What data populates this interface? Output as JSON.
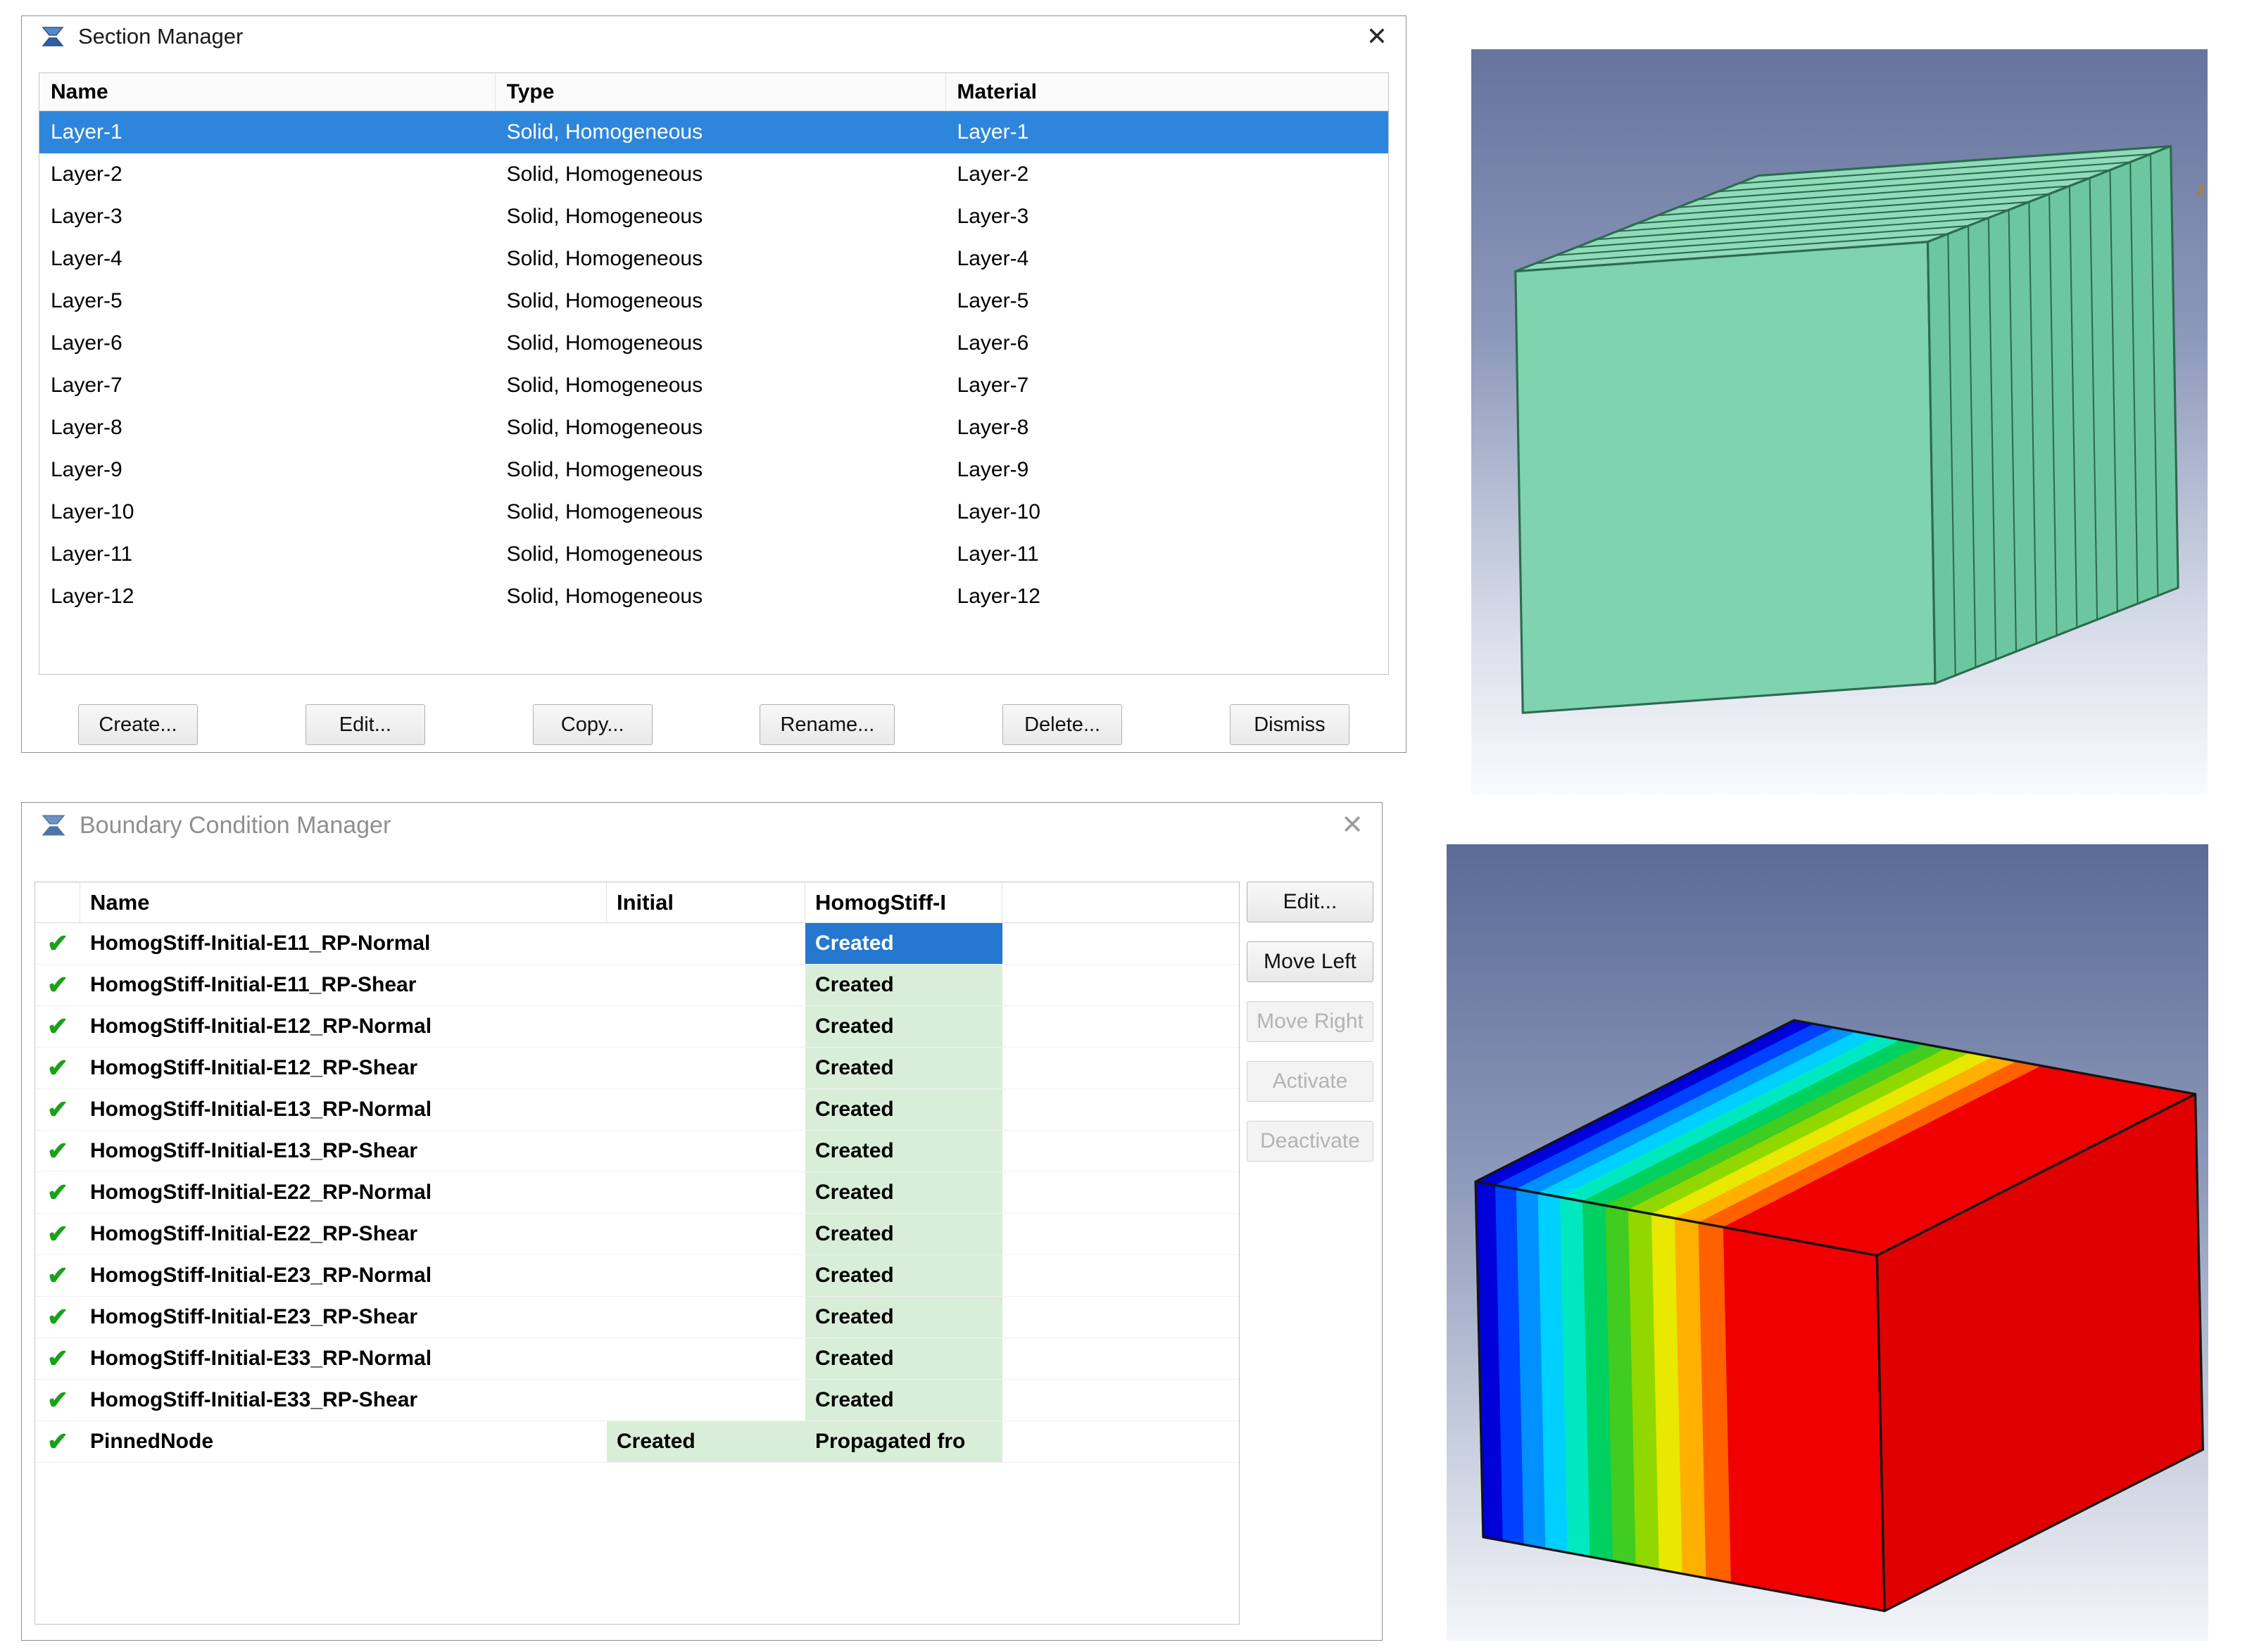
{
  "section_manager": {
    "title": "Section Manager",
    "close_glyph": "✕",
    "selection_color": "#2e86dc",
    "columns": [
      "Name",
      "Type",
      "Material"
    ],
    "rows": [
      {
        "name": "Layer-1",
        "type": "Solid, Homogeneous",
        "material": "Layer-1",
        "selected": true
      },
      {
        "name": "Layer-2",
        "type": "Solid, Homogeneous",
        "material": "Layer-2",
        "selected": false
      },
      {
        "name": "Layer-3",
        "type": "Solid, Homogeneous",
        "material": "Layer-3",
        "selected": false
      },
      {
        "name": "Layer-4",
        "type": "Solid, Homogeneous",
        "material": "Layer-4",
        "selected": false
      },
      {
        "name": "Layer-5",
        "type": "Solid, Homogeneous",
        "material": "Layer-5",
        "selected": false
      },
      {
        "name": "Layer-6",
        "type": "Solid, Homogeneous",
        "material": "Layer-6",
        "selected": false
      },
      {
        "name": "Layer-7",
        "type": "Solid, Homogeneous",
        "material": "Layer-7",
        "selected": false
      },
      {
        "name": "Layer-8",
        "type": "Solid, Homogeneous",
        "material": "Layer-8",
        "selected": false
      },
      {
        "name": "Layer-9",
        "type": "Solid, Homogeneous",
        "material": "Layer-9",
        "selected": false
      },
      {
        "name": "Layer-10",
        "type": "Solid, Homogeneous",
        "material": "Layer-10",
        "selected": false
      },
      {
        "name": "Layer-11",
        "type": "Solid, Homogeneous",
        "material": "Layer-11",
        "selected": false
      },
      {
        "name": "Layer-12",
        "type": "Solid, Homogeneous",
        "material": "Layer-12",
        "selected": false
      }
    ],
    "buttons": [
      "Create...",
      "Edit...",
      "Copy...",
      "Rename...",
      "Delete...",
      "Dismiss"
    ]
  },
  "bc_manager": {
    "title": "Boundary Condition Manager",
    "close_glyph": "✕",
    "check_glyph": "✔",
    "check_color": "#1aa11a",
    "created_bg": "#d9eed9",
    "selection_color": "#2577d0",
    "columns": [
      "Name",
      "Initial",
      "HomogStiff-I"
    ],
    "rows": [
      {
        "name": "HomogStiff-Initial-E11_RP-Normal",
        "initial": "",
        "step": "Created",
        "selected": true
      },
      {
        "name": "HomogStiff-Initial-E11_RP-Shear",
        "initial": "",
        "step": "Created",
        "selected": false
      },
      {
        "name": "HomogStiff-Initial-E12_RP-Normal",
        "initial": "",
        "step": "Created",
        "selected": false
      },
      {
        "name": "HomogStiff-Initial-E12_RP-Shear",
        "initial": "",
        "step": "Created",
        "selected": false
      },
      {
        "name": "HomogStiff-Initial-E13_RP-Normal",
        "initial": "",
        "step": "Created",
        "selected": false
      },
      {
        "name": "HomogStiff-Initial-E13_RP-Shear",
        "initial": "",
        "step": "Created",
        "selected": false
      },
      {
        "name": "HomogStiff-Initial-E22_RP-Normal",
        "initial": "",
        "step": "Created",
        "selected": false
      },
      {
        "name": "HomogStiff-Initial-E22_RP-Shear",
        "initial": "",
        "step": "Created",
        "selected": false
      },
      {
        "name": "HomogStiff-Initial-E23_RP-Normal",
        "initial": "",
        "step": "Created",
        "selected": false
      },
      {
        "name": "HomogStiff-Initial-E23_RP-Shear",
        "initial": "",
        "step": "Created",
        "selected": false
      },
      {
        "name": "HomogStiff-Initial-E33_RP-Normal",
        "initial": "",
        "step": "Created",
        "selected": false
      },
      {
        "name": "HomogStiff-Initial-E33_RP-Shear",
        "initial": "",
        "step": "Created",
        "selected": false
      },
      {
        "name": "PinnedNode",
        "initial": "Created",
        "step": "Propagated fro",
        "selected": false
      }
    ],
    "buttons": [
      {
        "label": "Edit...",
        "enabled": true
      },
      {
        "label": "Move Left",
        "enabled": true
      },
      {
        "label": "Move Right",
        "enabled": false
      },
      {
        "label": "Activate",
        "enabled": false
      },
      {
        "label": "Deactivate",
        "enabled": false
      }
    ]
  },
  "viewports": {
    "layered_cube": {
      "n_layers": 12,
      "axis_label": "z",
      "axis_label_color": "#c27c00",
      "colors": {
        "front": "#7fd3ae",
        "top": "#90dcba",
        "right": "#6cc7a0",
        "edge": "#2d6b51"
      }
    },
    "contour_cube": {
      "band_colors": [
        "#0000d8",
        "#0040ff",
        "#0090ff",
        "#00d0ff",
        "#00e8c0",
        "#00d060",
        "#40cc20",
        "#90d800",
        "#e8e800",
        "#ffb000",
        "#ff6000",
        "#f00000"
      ],
      "band_widths": [
        0.05,
        0.052,
        0.054,
        0.055,
        0.056,
        0.057,
        0.057,
        0.058,
        0.058,
        0.059,
        0.062,
        0.382
      ],
      "right_face_color": "#e00000",
      "edge": "#141414"
    }
  }
}
